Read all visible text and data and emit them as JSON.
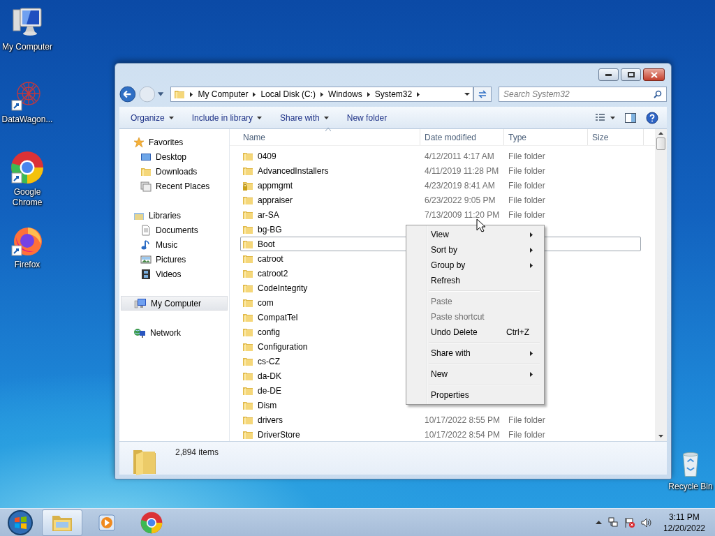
{
  "desktop_icons": [
    {
      "label": "My Computer",
      "kind": "computer",
      "shortcut": false
    },
    {
      "label": "DataWagon...",
      "kind": "network",
      "shortcut": true
    },
    {
      "label": "Google Chrome",
      "kind": "chrome",
      "shortcut": true
    },
    {
      "label": "Firefox",
      "kind": "firefox",
      "shortcut": true
    },
    {
      "label": "Recycle Bin",
      "kind": "bin",
      "shortcut": false
    }
  ],
  "explorer": {
    "address": [
      "My Computer",
      "Local Disk (C:)",
      "Windows",
      "System32"
    ],
    "search": {
      "placeholder": "Search System32"
    },
    "toolbar": [
      {
        "label": "Organize",
        "dropdown": true
      },
      {
        "label": "Include in library",
        "dropdown": true
      },
      {
        "label": "Share with",
        "dropdown": true
      },
      {
        "label": "New folder",
        "dropdown": false
      }
    ],
    "sidebar": [
      {
        "label": "Favorites",
        "selected": false,
        "children": [
          {
            "label": "Desktop",
            "selected": false
          },
          {
            "label": "Downloads",
            "selected": false
          },
          {
            "label": "Recent Places",
            "selected": false
          }
        ]
      },
      {
        "label": "Libraries",
        "selected": false,
        "children": [
          {
            "label": "Documents",
            "selected": false
          },
          {
            "label": "Music",
            "selected": false
          },
          {
            "label": "Pictures",
            "selected": false
          },
          {
            "label": "Videos",
            "selected": false
          }
        ]
      },
      {
        "label": "My Computer",
        "selected": true
      },
      {
        "label": "Network",
        "selected": false
      }
    ],
    "columns": [
      "Name",
      "Date modified",
      "Type",
      "Size"
    ],
    "rows": [
      {
        "name": "0409",
        "date": "4/12/2011 4:17 AM",
        "type": "File folder",
        "focused": false,
        "locked": false
      },
      {
        "name": "AdvancedInstallers",
        "date": "4/11/2019 11:28 PM",
        "type": "File folder",
        "focused": false,
        "locked": false
      },
      {
        "name": "appmgmt",
        "date": "4/23/2019 8:41 AM",
        "type": "File folder",
        "focused": false,
        "locked": true
      },
      {
        "name": "appraiser",
        "date": "6/23/2022 9:05 PM",
        "type": "File folder",
        "focused": false,
        "locked": false
      },
      {
        "name": "ar-SA",
        "date": "7/13/2009 11:20 PM",
        "type": "File folder",
        "focused": false,
        "locked": false
      },
      {
        "name": "bg-BG",
        "focused": false,
        "locked": false
      },
      {
        "name": "Boot",
        "focused": true,
        "locked": false
      },
      {
        "name": "catroot",
        "focused": false,
        "locked": false
      },
      {
        "name": "catroot2",
        "focused": false,
        "locked": false
      },
      {
        "name": "CodeIntegrity",
        "focused": false,
        "locked": false
      },
      {
        "name": "com",
        "focused": false,
        "locked": false
      },
      {
        "name": "CompatTel",
        "focused": false,
        "locked": false
      },
      {
        "name": "config",
        "focused": false,
        "locked": false
      },
      {
        "name": "Configuration",
        "focused": false,
        "locked": false
      },
      {
        "name": "cs-CZ",
        "focused": false,
        "locked": false
      },
      {
        "name": "da-DK",
        "focused": false,
        "locked": false
      },
      {
        "name": "de-DE",
        "focused": false,
        "locked": false
      },
      {
        "name": "Dism",
        "focused": false,
        "locked": false
      },
      {
        "name": "drivers",
        "date": "10/17/2022 8:55 PM",
        "type": "File folder",
        "focused": false,
        "locked": false
      },
      {
        "name": "DriverStore",
        "date": "10/17/2022 8:54 PM",
        "type": "File folder",
        "focused": false,
        "locked": false
      }
    ],
    "status": "2,894 items"
  },
  "context_menu": [
    [
      {
        "label": "View",
        "submenu": true,
        "disabled": false
      },
      {
        "label": "Sort by",
        "submenu": true,
        "disabled": false
      },
      {
        "label": "Group by",
        "submenu": true,
        "disabled": false
      },
      {
        "label": "Refresh",
        "submenu": false,
        "disabled": false
      }
    ],
    [
      {
        "label": "Paste",
        "submenu": false,
        "disabled": true
      },
      {
        "label": "Paste shortcut",
        "submenu": false,
        "disabled": true
      },
      {
        "label": "Undo Delete",
        "shortcut": "Ctrl+Z",
        "submenu": false,
        "disabled": false
      }
    ],
    [
      {
        "label": "Share with",
        "submenu": true,
        "disabled": false
      }
    ],
    [
      {
        "label": "New",
        "submenu": true,
        "disabled": false
      }
    ],
    [
      {
        "label": "Properties",
        "submenu": false,
        "disabled": false
      }
    ]
  ],
  "taskbar": {
    "apps": [
      {
        "kind": "explorer",
        "selected": true
      },
      {
        "kind": "media",
        "selected": false
      },
      {
        "kind": "chrome",
        "selected": false
      }
    ],
    "time": "3:11 PM",
    "date": "12/20/2022"
  }
}
